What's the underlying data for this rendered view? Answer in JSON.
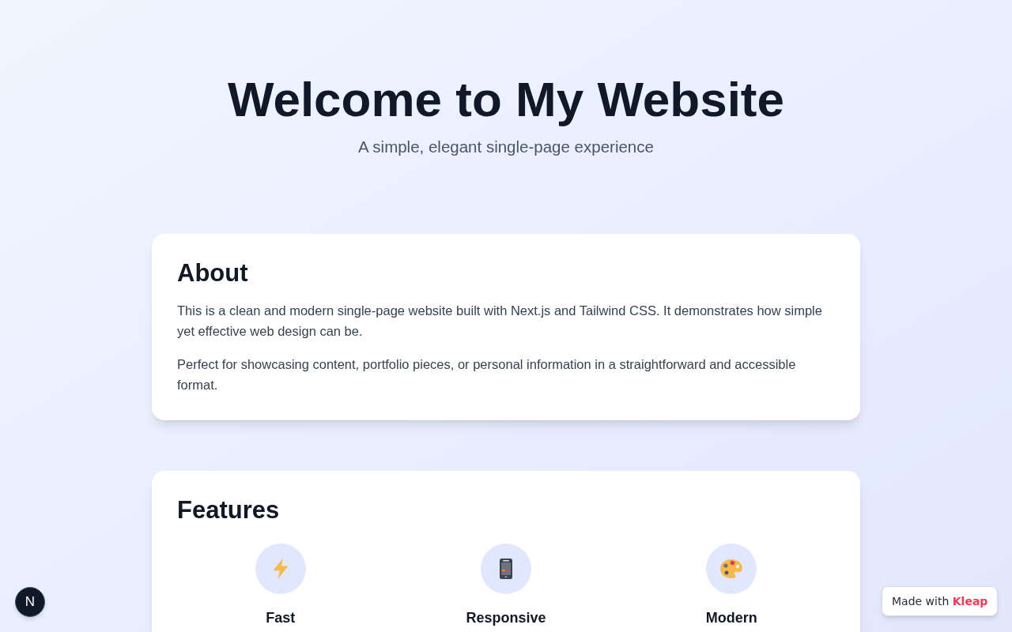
{
  "hero": {
    "title": "Welcome to My Website",
    "subtitle": "A simple, elegant single-page experience"
  },
  "about": {
    "heading": "About",
    "paragraphs": [
      "This is a clean and modern single-page website built with Next.js and Tailwind CSS. It demonstrates how simple yet effective web design can be.",
      "Perfect for showcasing content, portfolio pieces, or personal information in a straightforward and accessible format."
    ]
  },
  "features": {
    "heading": "Features",
    "items": [
      {
        "title": "Fast"
      },
      {
        "title": "Responsive"
      },
      {
        "title": "Modern"
      }
    ]
  },
  "dev_indicator": {
    "label": "N"
  },
  "made_with_badge": {
    "text": "Made with **Kleap**"
  }
}
